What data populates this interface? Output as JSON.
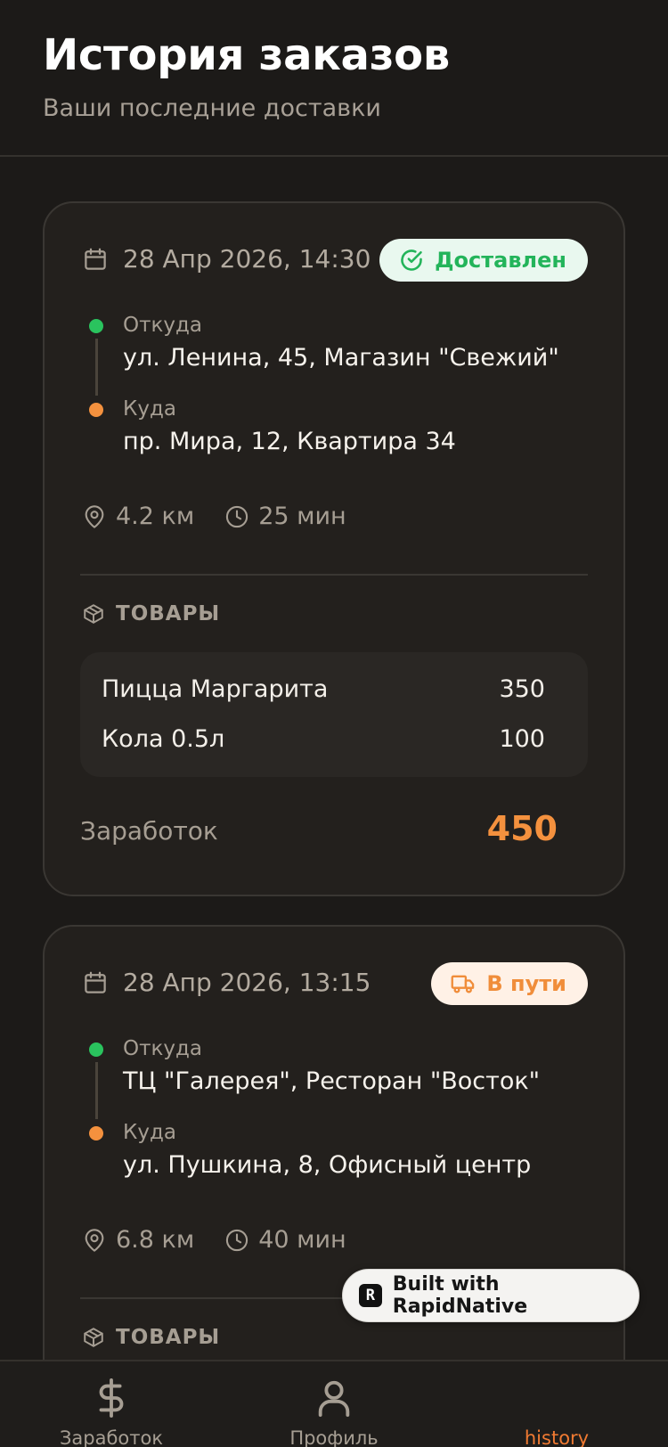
{
  "header": {
    "title": "История заказов",
    "subtitle": "Ваши последние доставки"
  },
  "orders": [
    {
      "date": "28 Апр 2026, 14:30",
      "status": {
        "label": "Доставлен",
        "icon": "check-circle-icon",
        "color": "#23b45a",
        "bg": "#e9f8ef"
      },
      "from_label": "Откуда",
      "from": "ул. Ленина, 45, Магазин \"Свежий\"",
      "to_label": "Куда",
      "to": "пр. Мира, 12, Квартира 34",
      "distance": "4.2 км",
      "duration": "25 мин",
      "goods_title": "ТОВАРЫ",
      "items": [
        {
          "name": "Пицца Маргарита",
          "price": "350"
        },
        {
          "name": "Кола 0.5л",
          "price": "100"
        }
      ],
      "earnings_label": "Заработок",
      "earnings": "450"
    },
    {
      "date": "28 Апр 2026, 13:15",
      "status": {
        "label": "В пути",
        "icon": "truck-icon",
        "color": "#f08d3a",
        "bg": "#fff1e6"
      },
      "from_label": "Откуда",
      "from": "ТЦ \"Галерея\", Ресторан \"Восток\"",
      "to_label": "Куда",
      "to": "ул. Пушкина, 8, Офисный центр",
      "distance": "6.8 км",
      "duration": "40 мин",
      "goods_title": "ТОВАРЫ"
    }
  ],
  "rapidnative": {
    "logo": "R",
    "label": "Built with RapidNative"
  },
  "tabs": [
    {
      "label": "Заработок",
      "icon": "dollar-icon",
      "active": false
    },
    {
      "label": "Профиль",
      "icon": "user-icon",
      "active": false
    },
    {
      "label": "history",
      "icon": "history-icon",
      "active": true
    }
  ],
  "colors": {
    "background": "#1c1a18",
    "card": "#23201d",
    "accent": "#f4913e",
    "from_dot": "#2ac35e",
    "to_dot": "#f4913e"
  }
}
